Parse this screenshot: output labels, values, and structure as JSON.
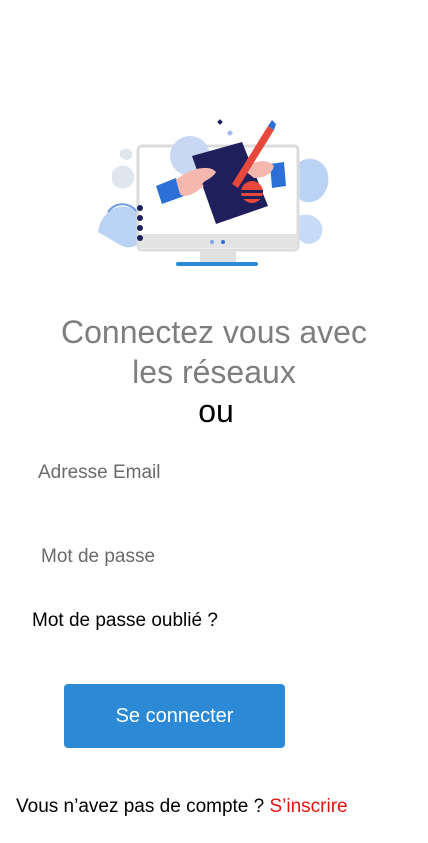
{
  "hero": {
    "illustration": "login-illustration"
  },
  "title": {
    "line1": "Connectez vous avec",
    "line2": "les réseaux",
    "or": "ou"
  },
  "form": {
    "email_placeholder": "Adresse Email",
    "password_placeholder": "Mot de passe",
    "forgot_label": "Mot de passe oublié ?",
    "login_label": "Se connecter"
  },
  "footer": {
    "prompt": "Vous n’avez pas de compte ?",
    "signup_label": "S’inscrire"
  },
  "colors": {
    "primary": "#2c89d6",
    "link": "#e0140f",
    "muted_text": "#7e7e7e"
  }
}
